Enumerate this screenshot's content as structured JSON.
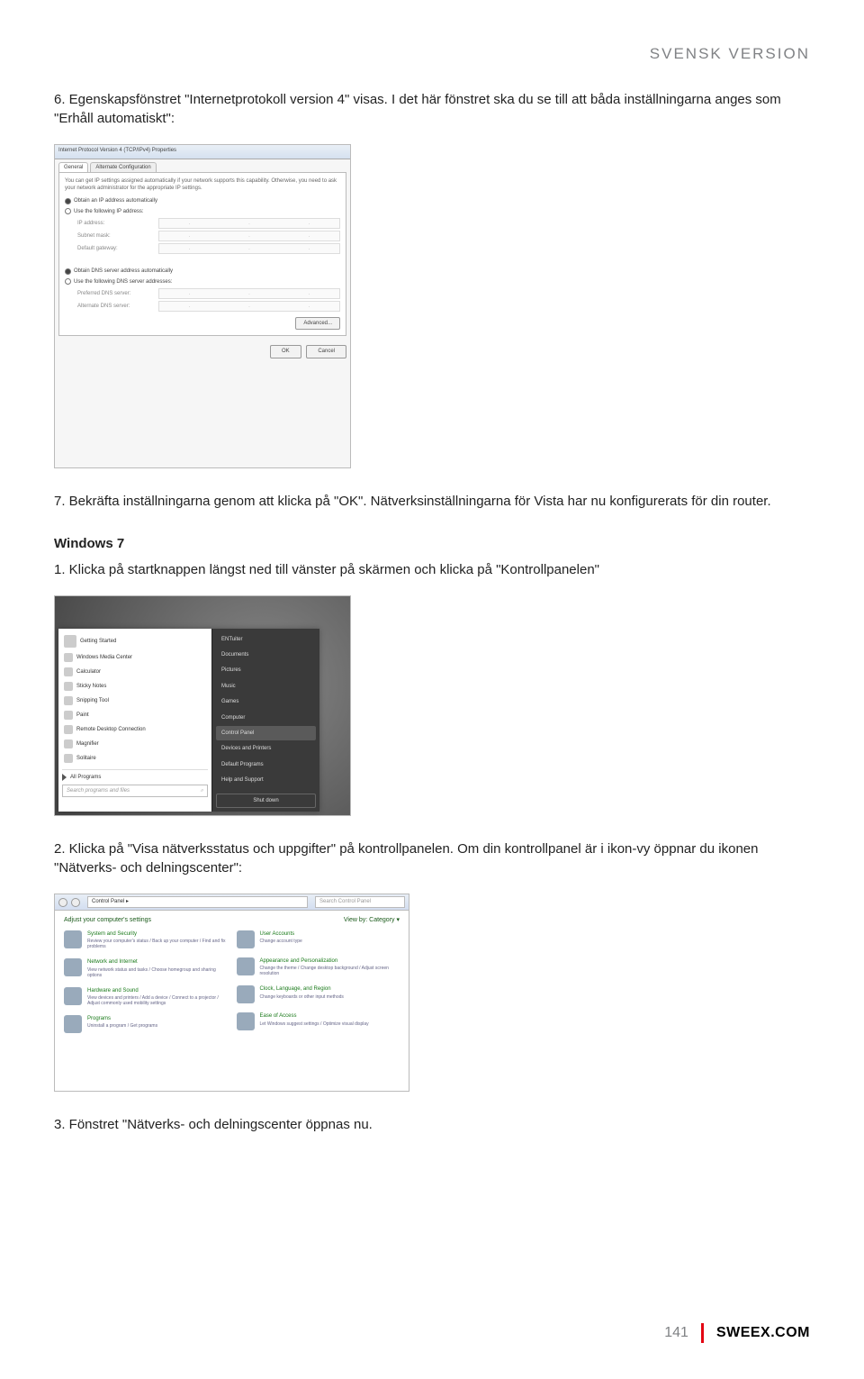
{
  "header": {
    "title": "SVENSK VERSION"
  },
  "steps": {
    "s6": "6.  Egenskapsfönstret \"Internetprotokoll version 4\" visas. I det här fönstret ska du se till att båda inställningarna anges som \"Erhåll automatiskt\":",
    "s7": "7.  Bekräfta inställningarna genom att klicka på \"OK\". Nätverksinställningarna för Vista har nu konfigurerats för din router.",
    "subheading": "Windows 7",
    "w1": "1.  Klicka på startknappen längst ned till vänster på skärmen och klicka på \"Kontrollpanelen\"",
    "w2": "2.  Klicka på \"Visa nätverksstatus och uppgifter\" på kontrollpanelen. Om din kontrollpanel är i ikon-vy öppnar du ikonen \"Nätverks- och delningscenter\":",
    "w3": "3.  Fönstret \"Nätverks- och delningscenter öppnas nu."
  },
  "ss1": {
    "title": "Internet Protocol Version 4 (TCP/IPv4) Properties",
    "tab1": "General",
    "tab2": "Alternate Configuration",
    "desc": "You can get IP settings assigned automatically if your network supports this capability. Otherwise, you need to ask your network administrator for the appropriate IP settings.",
    "r1": "Obtain an IP address automatically",
    "r2": "Use the following IP address:",
    "f1": "IP address:",
    "f2": "Subnet mask:",
    "f3": "Default gateway:",
    "r3": "Obtain DNS server address automatically",
    "r4": "Use the following DNS server addresses:",
    "f4": "Preferred DNS server:",
    "f5": "Alternate DNS server:",
    "adv": "Advanced...",
    "ok": "OK",
    "cancel": "Cancel"
  },
  "ss2": {
    "left": [
      "Getting Started",
      "Windows Media Center",
      "Calculator",
      "Sticky Notes",
      "Snipping Tool",
      "Paint",
      "Remote Desktop Connection",
      "Magnifier",
      "Solitaire"
    ],
    "allprograms": "All Programs",
    "searchPlaceholder": "Search programs and files",
    "right": [
      "ENTuiter",
      "Documents",
      "Pictures",
      "Music",
      "Games",
      "Computer",
      "Control Panel",
      "Devices and Printers",
      "Default Programs",
      "Help and Support"
    ],
    "shutdown": "Shut down"
  },
  "ss3": {
    "crumb": "Control Panel ▸",
    "search": "Search Control Panel",
    "heading": "Adjust your computer's settings",
    "viewby": "View by:   Category ▾",
    "leftcats": [
      {
        "h": "System and Security",
        "s": "Review your computer's status / Back up your computer / Find and fix problems"
      },
      {
        "h": "Network and Internet",
        "s": "View network status and tasks / Choose homegroup and sharing options"
      },
      {
        "h": "Hardware and Sound",
        "s": "View devices and printers / Add a device / Connect to a projector / Adjust commonly used mobility settings"
      },
      {
        "h": "Programs",
        "s": "Uninstall a program / Get programs"
      }
    ],
    "rightcats": [
      {
        "h": "User Accounts",
        "s": "Change account type"
      },
      {
        "h": "Appearance and Personalization",
        "s": "Change the theme / Change desktop background / Adjust screen resolution"
      },
      {
        "h": "Clock, Language, and Region",
        "s": "Change keyboards or other input methods"
      },
      {
        "h": "Ease of Access",
        "s": "Let Windows suggest settings / Optimize visual display"
      }
    ]
  },
  "footer": {
    "pageNum": "141",
    "brand": "SWEEX.COM"
  }
}
